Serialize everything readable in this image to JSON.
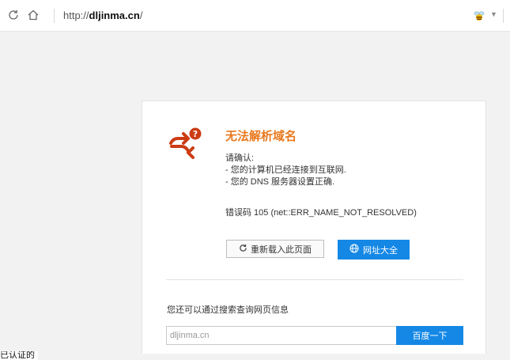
{
  "browser": {
    "url_prefix": "http://",
    "url_host": "dljinma.cn",
    "url_suffix": "/",
    "icons": {
      "refresh": "refresh-icon",
      "home": "home-icon",
      "extension": "bee-extension-icon"
    }
  },
  "error": {
    "title": "无法解析域名",
    "confirm_heading": "请确认:",
    "confirm_items": [
      "- 您的计算机已经连接到互联网.",
      "- 您的 DNS 服务器设置正确."
    ],
    "error_code": "错误码 105 (net::ERR_NAME_NOT_RESOLVED)",
    "reload_label": "重新载入此页面",
    "sites_label": "网址大全"
  },
  "search": {
    "hint": "您还可以通过搜索查询网页信息",
    "value": "dljinma.cn",
    "button_label": "百度一下"
  },
  "status": {
    "text": "已认证的"
  },
  "colors": {
    "accent_blue": "#1588e6",
    "title_orange": "#e8781d",
    "icon_red": "#cc3c14"
  }
}
